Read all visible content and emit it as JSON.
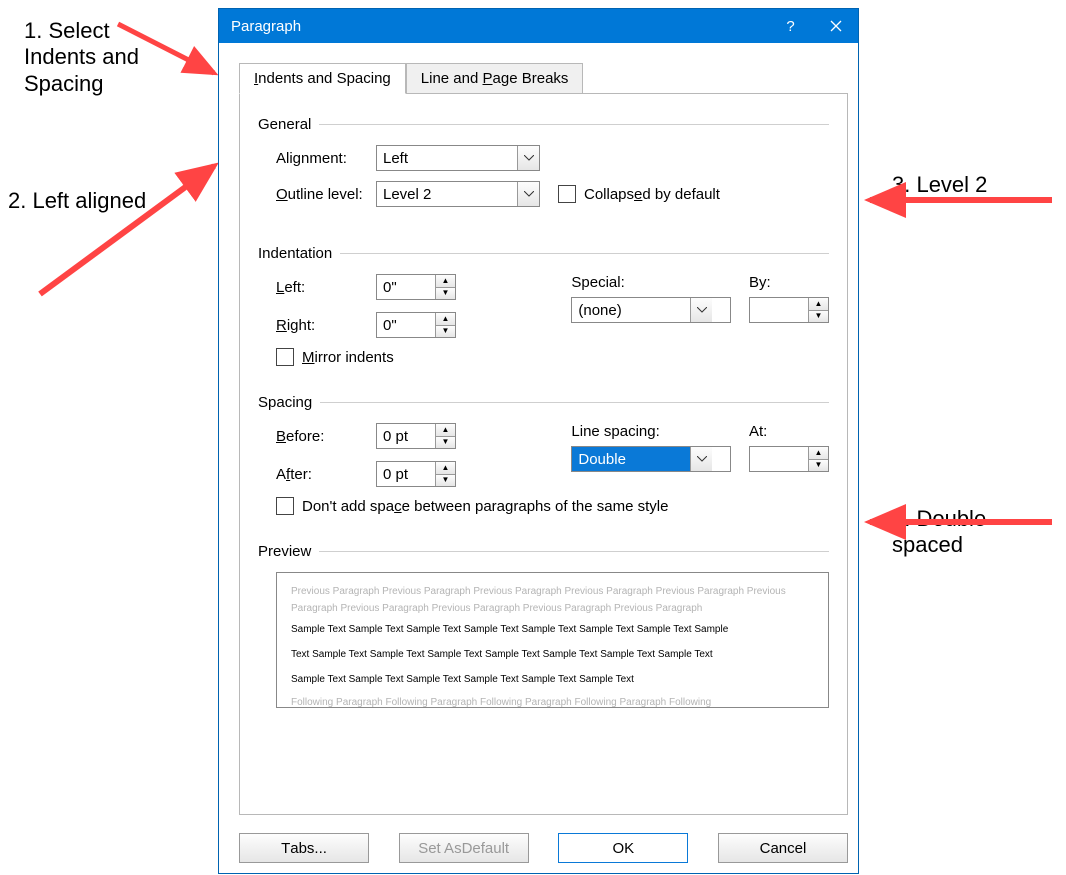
{
  "dialog": {
    "title": "Paragraph",
    "tabs": {
      "indents": "Indents and Spacing",
      "breaks": "Line and Page Breaks"
    },
    "general": {
      "legend": "General",
      "alignment_label": "Alignment:",
      "alignment_value": "Left",
      "outline_label": "Outline level:",
      "outline_value": "Level 2",
      "collapsed_label": "Collapsed by default"
    },
    "indentation": {
      "legend": "Indentation",
      "left_label": "Left:",
      "left_value": "0\"",
      "right_label": "Right:",
      "right_value": "0\"",
      "special_label": "Special:",
      "special_value": "(none)",
      "by_label": "By:",
      "by_value": "",
      "mirror_label": "Mirror indents"
    },
    "spacing": {
      "legend": "Spacing",
      "before_label": "Before:",
      "before_value": "0 pt",
      "after_label": "After:",
      "after_value": "0 pt",
      "line_label": "Line spacing:",
      "line_value": "Double",
      "at_label": "At:",
      "at_value": "",
      "dontadd_label": "Don't add space between paragraphs of the same style"
    },
    "preview": {
      "legend": "Preview",
      "prev": "Previous Paragraph Previous Paragraph Previous Paragraph Previous Paragraph Previous Paragraph Previous Paragraph Previous Paragraph Previous Paragraph Previous Paragraph Previous Paragraph",
      "sample1": "Sample Text Sample Text Sample Text Sample Text Sample Text Sample Text Sample Text Sample",
      "sample2": "Text Sample Text Sample Text Sample Text Sample Text Sample Text Sample Text Sample Text",
      "sample3": "Sample Text Sample Text Sample Text Sample Text Sample Text Sample Text",
      "next": "Following Paragraph Following Paragraph Following Paragraph Following Paragraph Following"
    },
    "buttons": {
      "tabs": "Tabs...",
      "default": "Set As Default",
      "ok": "OK",
      "cancel": "Cancel"
    }
  },
  "annotations": {
    "a1_line1": "1. Select",
    "a1_line2": "Indents and",
    "a1_line3": "Spacing",
    "a2": "2. Left aligned",
    "a3": "3. Level 2",
    "a4_line1": "4. Double",
    "a4_line2": "spaced"
  }
}
